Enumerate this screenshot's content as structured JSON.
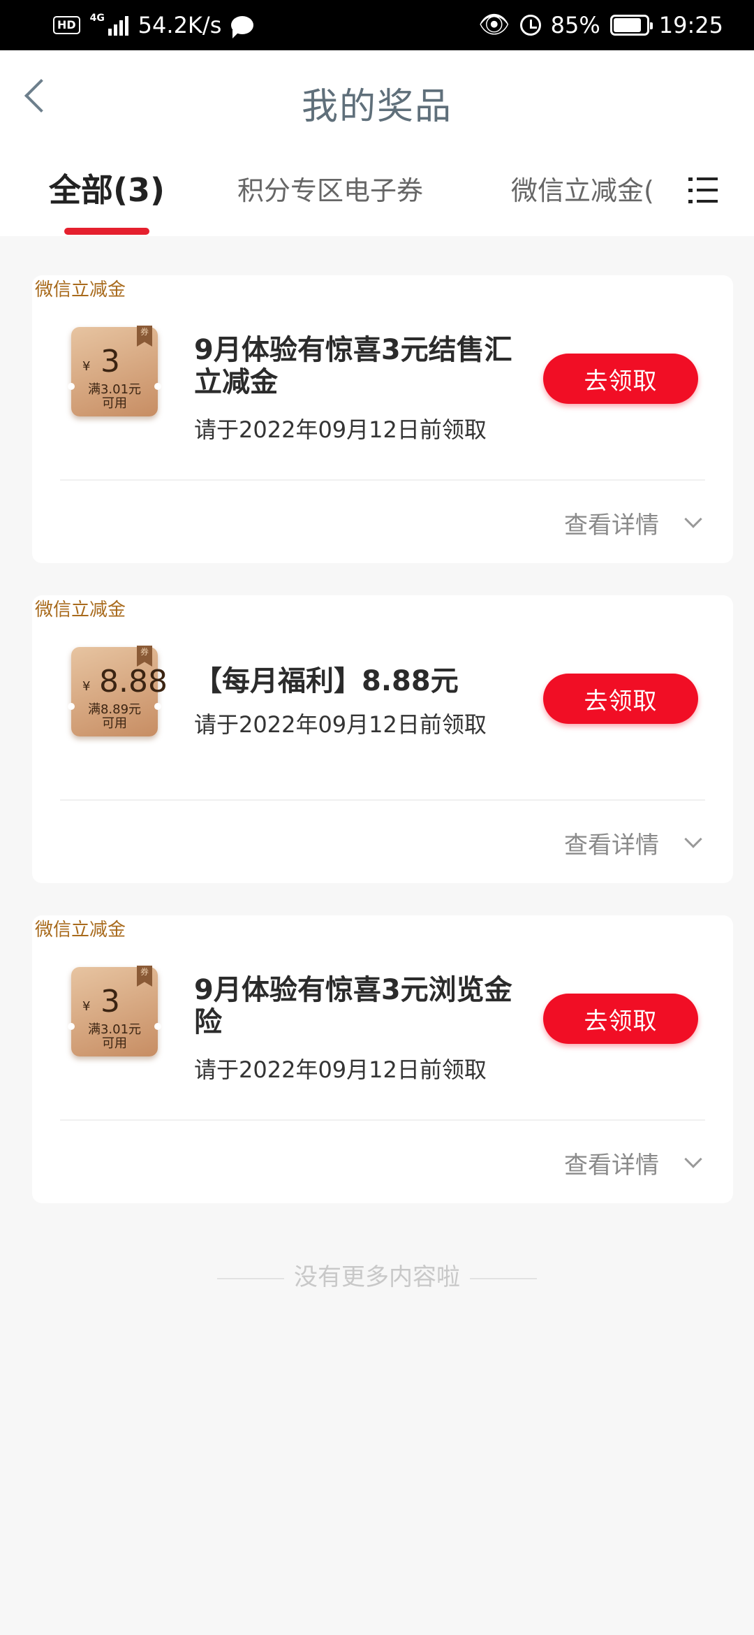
{
  "status_bar": {
    "hd": "HD",
    "network": "4G",
    "speed": "54.2K/s",
    "battery": "85%",
    "time": "19:25",
    "icons": [
      "hd-icon",
      "signal-icon",
      "chat-icon",
      "eye-icon",
      "alarm-icon",
      "battery-icon"
    ]
  },
  "header": {
    "title": "我的奖品"
  },
  "tabs": [
    {
      "label": "全部(3)",
      "active": true
    },
    {
      "label": "积分专区电子券",
      "active": false
    },
    {
      "label": "微信立减金(",
      "active": false
    }
  ],
  "cards": [
    {
      "tag": "微信立减金",
      "coupon": {
        "symbol": "¥",
        "amount": "3",
        "condition": "满3.01元",
        "usable": "可用",
        "ribbon": "券"
      },
      "title": "9月体验有惊喜3元结售汇立减金",
      "deadline": "请于2022年09月12日前领取",
      "button": "去领取",
      "details": "查看详情"
    },
    {
      "tag": "微信立减金",
      "coupon": {
        "symbol": "¥",
        "amount": "8.88",
        "condition": "满8.89元",
        "usable": "可用",
        "ribbon": "券"
      },
      "title": "【每月福利】8.88元",
      "deadline": "请于2022年09月12日前领取",
      "button": "去领取",
      "details": "查看详情"
    },
    {
      "tag": "微信立减金",
      "coupon": {
        "symbol": "¥",
        "amount": "3",
        "condition": "满3.01元",
        "usable": "可用",
        "ribbon": "券"
      },
      "title": "9月体验有惊喜3元浏览金险",
      "deadline": "请于2022年09月12日前领取",
      "button": "去领取",
      "details": "查看详情"
    }
  ],
  "footer": {
    "text": "没有更多内容啦"
  },
  "colors": {
    "accent": "#e5202e",
    "button": "#f10e25",
    "tag": "#a86a1c"
  }
}
